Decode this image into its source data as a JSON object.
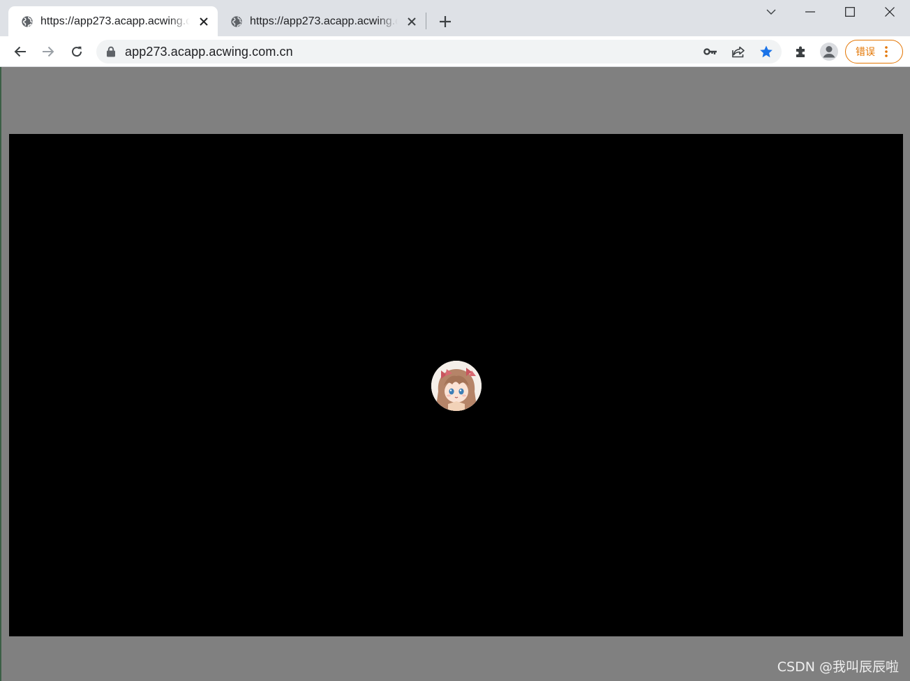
{
  "browser": {
    "tabs": [
      {
        "title": "https://app273.acapp.acwing.com.cn",
        "active": true
      },
      {
        "title": "https://app273.acapp.acwing.com.cn",
        "active": false
      }
    ],
    "address": "app273.acapp.acwing.com.cn",
    "profile_status_label": "错误",
    "accent_error_color": "#e37400",
    "star_color": "#1a73e8"
  },
  "icons": {
    "tab_favicon": "globe-icon",
    "tab_close": "close-icon",
    "new_tab": "plus-icon",
    "tab_search": "chevron-down-icon",
    "window_controls": [
      "minimize-icon",
      "maximize-icon",
      "close-icon"
    ],
    "nav": [
      "back-arrow-icon",
      "forward-arrow-icon",
      "reload-icon"
    ],
    "omnibox": [
      "lock-icon",
      "key-icon",
      "share-icon",
      "star-icon"
    ],
    "toolbar": [
      "puzzle-icon",
      "profile-icon",
      "kebab-menu-icon"
    ]
  },
  "page": {
    "background_color": "#808080",
    "game_canvas_color": "#000000",
    "player_avatar": "anime-girl-avatar"
  },
  "watermark": "CSDN @我叫辰辰啦"
}
